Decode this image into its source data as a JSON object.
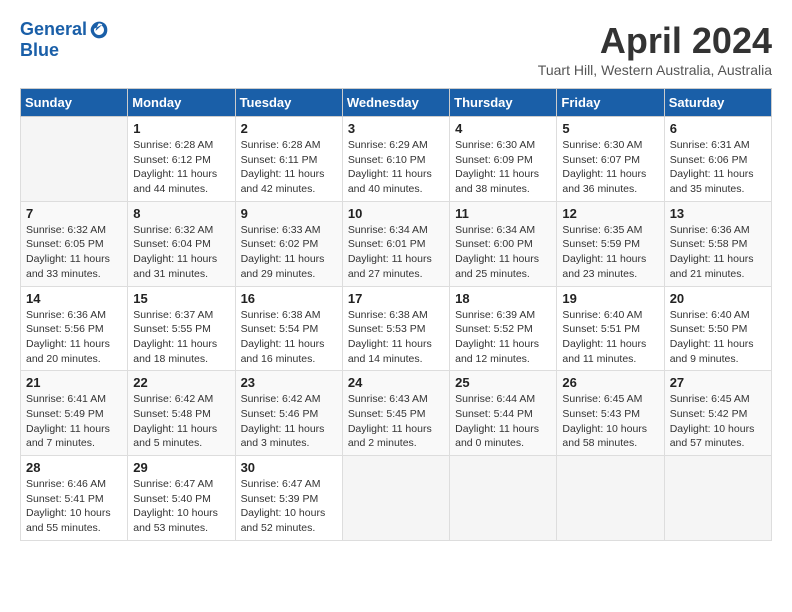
{
  "logo": {
    "line1": "General",
    "line2": "Blue"
  },
  "title": "April 2024",
  "subtitle": "Tuart Hill, Western Australia, Australia",
  "headers": [
    "Sunday",
    "Monday",
    "Tuesday",
    "Wednesday",
    "Thursday",
    "Friday",
    "Saturday"
  ],
  "weeks": [
    [
      {
        "day": "",
        "sunrise": "",
        "sunset": "",
        "daylight": ""
      },
      {
        "day": "1",
        "sunrise": "Sunrise: 6:28 AM",
        "sunset": "Sunset: 6:12 PM",
        "daylight": "Daylight: 11 hours and 44 minutes."
      },
      {
        "day": "2",
        "sunrise": "Sunrise: 6:28 AM",
        "sunset": "Sunset: 6:11 PM",
        "daylight": "Daylight: 11 hours and 42 minutes."
      },
      {
        "day": "3",
        "sunrise": "Sunrise: 6:29 AM",
        "sunset": "Sunset: 6:10 PM",
        "daylight": "Daylight: 11 hours and 40 minutes."
      },
      {
        "day": "4",
        "sunrise": "Sunrise: 6:30 AM",
        "sunset": "Sunset: 6:09 PM",
        "daylight": "Daylight: 11 hours and 38 minutes."
      },
      {
        "day": "5",
        "sunrise": "Sunrise: 6:30 AM",
        "sunset": "Sunset: 6:07 PM",
        "daylight": "Daylight: 11 hours and 36 minutes."
      },
      {
        "day": "6",
        "sunrise": "Sunrise: 6:31 AM",
        "sunset": "Sunset: 6:06 PM",
        "daylight": "Daylight: 11 hours and 35 minutes."
      }
    ],
    [
      {
        "day": "7",
        "sunrise": "Sunrise: 6:32 AM",
        "sunset": "Sunset: 6:05 PM",
        "daylight": "Daylight: 11 hours and 33 minutes."
      },
      {
        "day": "8",
        "sunrise": "Sunrise: 6:32 AM",
        "sunset": "Sunset: 6:04 PM",
        "daylight": "Daylight: 11 hours and 31 minutes."
      },
      {
        "day": "9",
        "sunrise": "Sunrise: 6:33 AM",
        "sunset": "Sunset: 6:02 PM",
        "daylight": "Daylight: 11 hours and 29 minutes."
      },
      {
        "day": "10",
        "sunrise": "Sunrise: 6:34 AM",
        "sunset": "Sunset: 6:01 PM",
        "daylight": "Daylight: 11 hours and 27 minutes."
      },
      {
        "day": "11",
        "sunrise": "Sunrise: 6:34 AM",
        "sunset": "Sunset: 6:00 PM",
        "daylight": "Daylight: 11 hours and 25 minutes."
      },
      {
        "day": "12",
        "sunrise": "Sunrise: 6:35 AM",
        "sunset": "Sunset: 5:59 PM",
        "daylight": "Daylight: 11 hours and 23 minutes."
      },
      {
        "day": "13",
        "sunrise": "Sunrise: 6:36 AM",
        "sunset": "Sunset: 5:58 PM",
        "daylight": "Daylight: 11 hours and 21 minutes."
      }
    ],
    [
      {
        "day": "14",
        "sunrise": "Sunrise: 6:36 AM",
        "sunset": "Sunset: 5:56 PM",
        "daylight": "Daylight: 11 hours and 20 minutes."
      },
      {
        "day": "15",
        "sunrise": "Sunrise: 6:37 AM",
        "sunset": "Sunset: 5:55 PM",
        "daylight": "Daylight: 11 hours and 18 minutes."
      },
      {
        "day": "16",
        "sunrise": "Sunrise: 6:38 AM",
        "sunset": "Sunset: 5:54 PM",
        "daylight": "Daylight: 11 hours and 16 minutes."
      },
      {
        "day": "17",
        "sunrise": "Sunrise: 6:38 AM",
        "sunset": "Sunset: 5:53 PM",
        "daylight": "Daylight: 11 hours and 14 minutes."
      },
      {
        "day": "18",
        "sunrise": "Sunrise: 6:39 AM",
        "sunset": "Sunset: 5:52 PM",
        "daylight": "Daylight: 11 hours and 12 minutes."
      },
      {
        "day": "19",
        "sunrise": "Sunrise: 6:40 AM",
        "sunset": "Sunset: 5:51 PM",
        "daylight": "Daylight: 11 hours and 11 minutes."
      },
      {
        "day": "20",
        "sunrise": "Sunrise: 6:40 AM",
        "sunset": "Sunset: 5:50 PM",
        "daylight": "Daylight: 11 hours and 9 minutes."
      }
    ],
    [
      {
        "day": "21",
        "sunrise": "Sunrise: 6:41 AM",
        "sunset": "Sunset: 5:49 PM",
        "daylight": "Daylight: 11 hours and 7 minutes."
      },
      {
        "day": "22",
        "sunrise": "Sunrise: 6:42 AM",
        "sunset": "Sunset: 5:48 PM",
        "daylight": "Daylight: 11 hours and 5 minutes."
      },
      {
        "day": "23",
        "sunrise": "Sunrise: 6:42 AM",
        "sunset": "Sunset: 5:46 PM",
        "daylight": "Daylight: 11 hours and 3 minutes."
      },
      {
        "day": "24",
        "sunrise": "Sunrise: 6:43 AM",
        "sunset": "Sunset: 5:45 PM",
        "daylight": "Daylight: 11 hours and 2 minutes."
      },
      {
        "day": "25",
        "sunrise": "Sunrise: 6:44 AM",
        "sunset": "Sunset: 5:44 PM",
        "daylight": "Daylight: 11 hours and 0 minutes."
      },
      {
        "day": "26",
        "sunrise": "Sunrise: 6:45 AM",
        "sunset": "Sunset: 5:43 PM",
        "daylight": "Daylight: 10 hours and 58 minutes."
      },
      {
        "day": "27",
        "sunrise": "Sunrise: 6:45 AM",
        "sunset": "Sunset: 5:42 PM",
        "daylight": "Daylight: 10 hours and 57 minutes."
      }
    ],
    [
      {
        "day": "28",
        "sunrise": "Sunrise: 6:46 AM",
        "sunset": "Sunset: 5:41 PM",
        "daylight": "Daylight: 10 hours and 55 minutes."
      },
      {
        "day": "29",
        "sunrise": "Sunrise: 6:47 AM",
        "sunset": "Sunset: 5:40 PM",
        "daylight": "Daylight: 10 hours and 53 minutes."
      },
      {
        "day": "30",
        "sunrise": "Sunrise: 6:47 AM",
        "sunset": "Sunset: 5:39 PM",
        "daylight": "Daylight: 10 hours and 52 minutes."
      },
      {
        "day": "",
        "sunrise": "",
        "sunset": "",
        "daylight": ""
      },
      {
        "day": "",
        "sunrise": "",
        "sunset": "",
        "daylight": ""
      },
      {
        "day": "",
        "sunrise": "",
        "sunset": "",
        "daylight": ""
      },
      {
        "day": "",
        "sunrise": "",
        "sunset": "",
        "daylight": ""
      }
    ]
  ]
}
